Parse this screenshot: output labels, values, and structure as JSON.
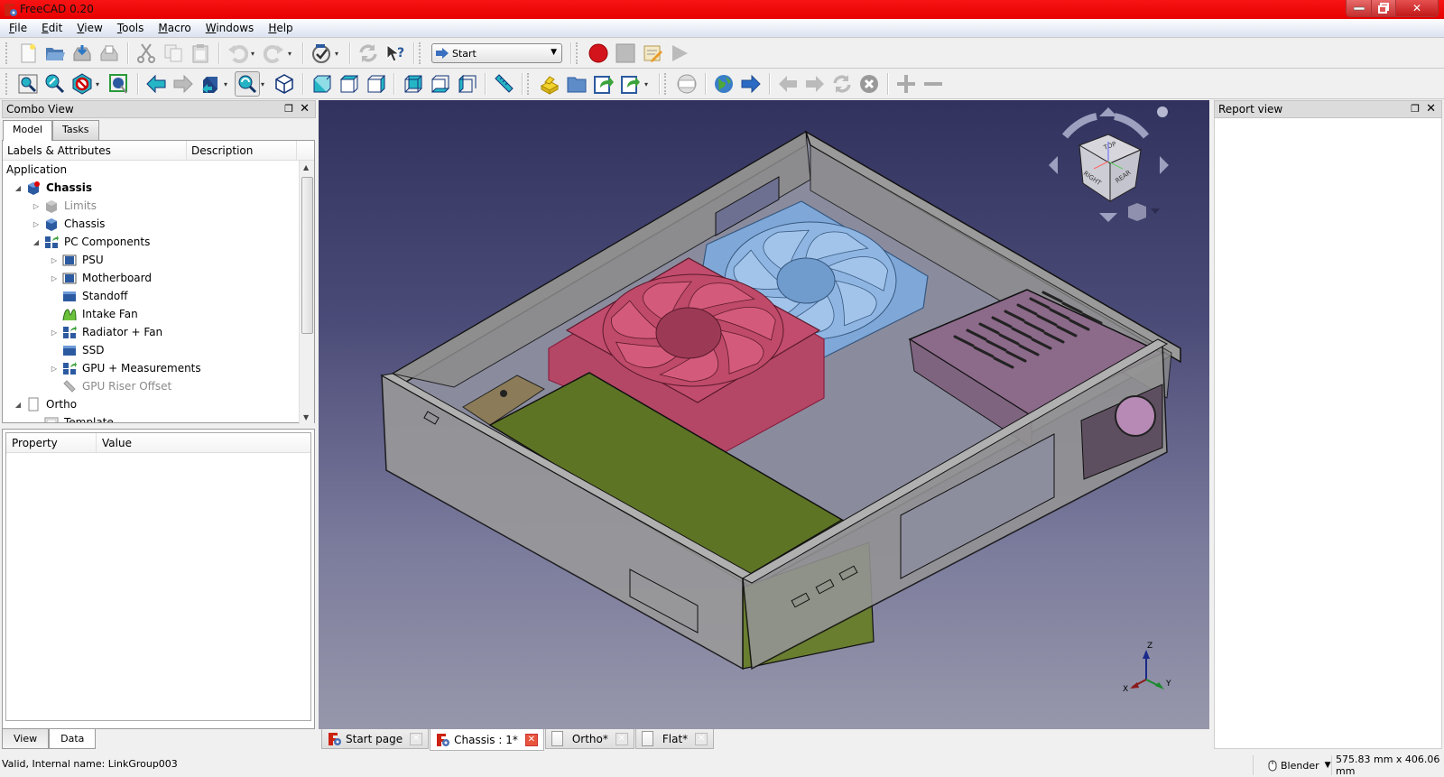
{
  "window": {
    "title": "FreeCAD 0.20",
    "minimize_label": "—",
    "maximize_label": "❐",
    "close_label": "✕"
  },
  "menu": [
    {
      "label": "File",
      "mnemonic": "F",
      "rest": "ile"
    },
    {
      "label": "Edit",
      "mnemonic": "E",
      "rest": "dit"
    },
    {
      "label": "View",
      "mnemonic": "V",
      "rest": "iew"
    },
    {
      "label": "Tools",
      "mnemonic": "T",
      "rest": "ools"
    },
    {
      "label": "Macro",
      "mnemonic": "M",
      "rest": "acro"
    },
    {
      "label": "Windows",
      "mnemonic": "W",
      "rest": "indows"
    },
    {
      "label": "Help",
      "mnemonic": "H",
      "rest": "elp"
    }
  ],
  "toolbar1": {
    "icons": [
      "new-file",
      "open-file",
      "save",
      "save-as",
      "cut",
      "copy",
      "paste",
      "undo",
      "redo",
      "refresh-check",
      "refresh",
      "whats-this"
    ],
    "workbench_selector": {
      "selected": "Start"
    },
    "macro_icons": [
      "record-macro",
      "stop-macro",
      "edit-macro",
      "run-macro"
    ]
  },
  "toolbar2": {
    "icons": [
      "fit-all",
      "fit-selection",
      "draw-style",
      "bounding-box",
      "back",
      "forward",
      "sync-view",
      "box-zoom",
      "isometric",
      "front",
      "top",
      "right",
      "rear",
      "bottom",
      "left",
      "measure",
      "make-part",
      "make-group",
      "make-link",
      "link-actions",
      "web-home",
      "web-open",
      "web-navigate",
      "web-back",
      "web-forward",
      "web-refresh",
      "web-stop",
      "zoom-in",
      "zoom-out"
    ]
  },
  "combo_view": {
    "title": "Combo View",
    "tabs": [
      {
        "label": "Model",
        "active": true
      },
      {
        "label": "Tasks",
        "active": false
      }
    ],
    "tree_headers": [
      "Labels & Attributes",
      "Description"
    ],
    "tree": [
      {
        "label": "Application",
        "level": 0,
        "expander": "",
        "icon": "none",
        "style": "normal"
      },
      {
        "label": "Chassis",
        "level": 1,
        "expander": "◢",
        "icon": "document",
        "style": "bold"
      },
      {
        "label": "Limits",
        "level": 2,
        "expander": "▷",
        "icon": "part-grey",
        "style": "dim"
      },
      {
        "label": "Chassis",
        "level": 2,
        "expander": "▷",
        "icon": "part-blue",
        "style": "normal"
      },
      {
        "label": "PC Components",
        "level": 2,
        "expander": "◢",
        "icon": "link-group",
        "style": "normal"
      },
      {
        "label": "PSU",
        "level": 3,
        "expander": "▷",
        "icon": "link-box",
        "style": "normal"
      },
      {
        "label": "Motherboard",
        "level": 3,
        "expander": "▷",
        "icon": "link-box",
        "style": "normal"
      },
      {
        "label": "Standoff",
        "level": 3,
        "expander": "",
        "icon": "solid-box",
        "style": "normal"
      },
      {
        "label": "Intake Fan",
        "level": 3,
        "expander": "",
        "icon": "mesh-green",
        "style": "normal"
      },
      {
        "label": "Radiator + Fan",
        "level": 3,
        "expander": "▷",
        "icon": "link-group",
        "style": "normal"
      },
      {
        "label": "SSD",
        "level": 3,
        "expander": "",
        "icon": "solid-box",
        "style": "normal"
      },
      {
        "label": "GPU + Measurements",
        "level": 3,
        "expander": "▷",
        "icon": "link-group",
        "style": "normal"
      },
      {
        "label": "GPU Riser Offset",
        "level": 3,
        "expander": "",
        "icon": "measure-grey",
        "style": "dim"
      },
      {
        "label": "Ortho",
        "level": 1,
        "expander": "◢",
        "icon": "page",
        "style": "normal"
      },
      {
        "label": "Template",
        "level": 2,
        "expander": "",
        "icon": "template",
        "style": "normal"
      }
    ],
    "property_headers": [
      "Property",
      "Value"
    ],
    "bottom_tabs": [
      {
        "label": "View",
        "active": false
      },
      {
        "label": "Data",
        "active": true
      }
    ]
  },
  "document_tabs": [
    {
      "label": "Start page",
      "icon": "freecad",
      "active": false
    },
    {
      "label": "Chassis : 1*",
      "icon": "freecad",
      "active": true
    },
    {
      "label": "Ortho*",
      "icon": "page",
      "active": false
    },
    {
      "label": "Flat*",
      "icon": "page",
      "active": false
    }
  ],
  "viewport": {
    "navcube_faces": [
      "TOP",
      "RIGHT",
      "REAR"
    ],
    "axis_labels": [
      "X",
      "Y",
      "Z"
    ],
    "colors": {
      "background_top": "#32325e",
      "background_bottom": "#9797ab",
      "chassis": "#8c8c8c",
      "gpu": "#5e7425",
      "front_fan": "#b54766",
      "rear_fan": "#7fa8d8",
      "psu": "#8c6a8a",
      "standoff": "#8c7b58"
    }
  },
  "report_view": {
    "title": "Report view"
  },
  "status": {
    "message": "Valid, Internal name: LinkGroup003",
    "navigation_style": "Blender",
    "dimensions": "575.83 mm x 406.06 mm"
  }
}
